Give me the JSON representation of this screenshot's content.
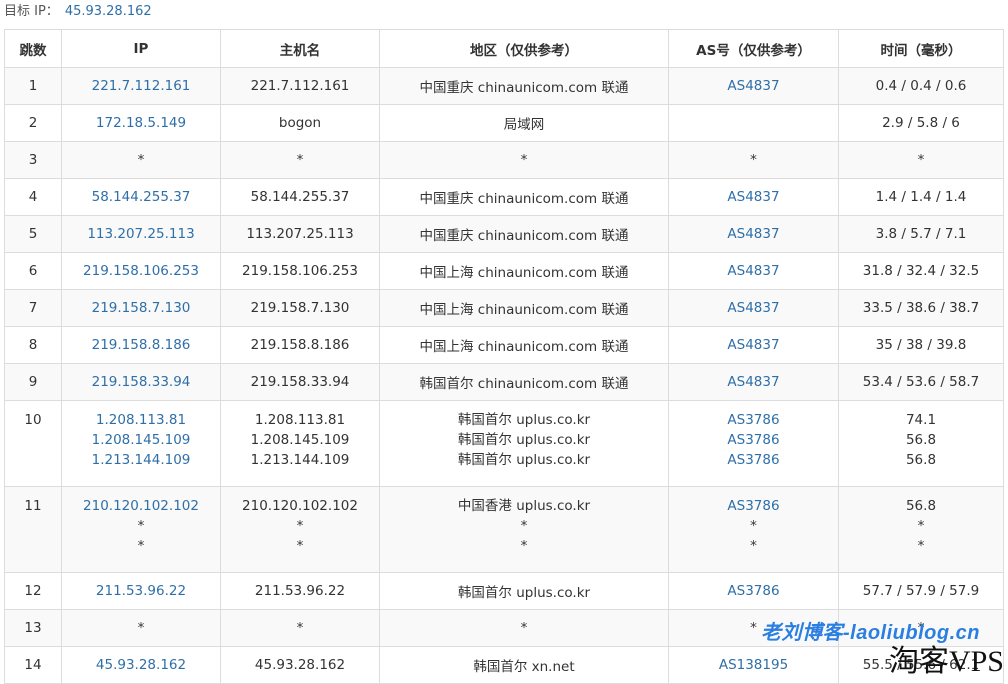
{
  "target": {
    "label": "目标 IP：",
    "ip": "45.93.28.162"
  },
  "headers": [
    "跳数",
    "IP",
    "主机名",
    "地区（仅供参考）",
    "AS号（仅供参考）",
    "时间（毫秒）"
  ],
  "rows": [
    {
      "hop": "1",
      "ips": [
        "221.7.112.161"
      ],
      "hosts": [
        "221.7.112.161"
      ],
      "regions": [
        "中国重庆 chinaunicom.com 联通"
      ],
      "as": [
        "AS4837"
      ],
      "times": [
        "0.4 / 0.4 / 0.6"
      ]
    },
    {
      "hop": "2",
      "ips": [
        "172.18.5.149"
      ],
      "hosts": [
        "bogon"
      ],
      "regions": [
        "局域网"
      ],
      "as": [
        ""
      ],
      "times": [
        "2.9 / 5.8 / 6"
      ]
    },
    {
      "hop": "3",
      "ips": [
        "*"
      ],
      "hosts": [
        "*"
      ],
      "regions": [
        "*"
      ],
      "as": [
        "*"
      ],
      "times": [
        "*"
      ]
    },
    {
      "hop": "4",
      "ips": [
        "58.144.255.37"
      ],
      "hosts": [
        "58.144.255.37"
      ],
      "regions": [
        "中国重庆 chinaunicom.com 联通"
      ],
      "as": [
        "AS4837"
      ],
      "times": [
        "1.4 / 1.4 / 1.4"
      ]
    },
    {
      "hop": "5",
      "ips": [
        "113.207.25.113"
      ],
      "hosts": [
        "113.207.25.113"
      ],
      "regions": [
        "中国重庆 chinaunicom.com 联通"
      ],
      "as": [
        "AS4837"
      ],
      "times": [
        "3.8 / 5.7 / 7.1"
      ]
    },
    {
      "hop": "6",
      "ips": [
        "219.158.106.253"
      ],
      "hosts": [
        "219.158.106.253"
      ],
      "regions": [
        "中国上海 chinaunicom.com 联通"
      ],
      "as": [
        "AS4837"
      ],
      "times": [
        "31.8 / 32.4 / 32.5"
      ]
    },
    {
      "hop": "7",
      "ips": [
        "219.158.7.130"
      ],
      "hosts": [
        "219.158.7.130"
      ],
      "regions": [
        "中国上海 chinaunicom.com 联通"
      ],
      "as": [
        "AS4837"
      ],
      "times": [
        "33.5 / 38.6 / 38.7"
      ]
    },
    {
      "hop": "8",
      "ips": [
        "219.158.8.186"
      ],
      "hosts": [
        "219.158.8.186"
      ],
      "regions": [
        "中国上海 chinaunicom.com 联通"
      ],
      "as": [
        "AS4837"
      ],
      "times": [
        "35 / 38 / 39.8"
      ]
    },
    {
      "hop": "9",
      "ips": [
        "219.158.33.94"
      ],
      "hosts": [
        "219.158.33.94"
      ],
      "regions": [
        "韩国首尔 chinaunicom.com 联通"
      ],
      "as": [
        "AS4837"
      ],
      "times": [
        "53.4 / 53.6 / 58.7"
      ]
    },
    {
      "hop": "10",
      "ips": [
        "1.208.113.81",
        "1.208.145.109",
        "1.213.144.109"
      ],
      "hosts": [
        "1.208.113.81",
        "1.208.145.109",
        "1.213.144.109"
      ],
      "regions": [
        "韩国首尔 uplus.co.kr",
        "韩国首尔 uplus.co.kr",
        "韩国首尔 uplus.co.kr"
      ],
      "as": [
        "AS3786",
        "AS3786",
        "AS3786"
      ],
      "times": [
        "74.1",
        "56.8",
        "56.8"
      ]
    },
    {
      "hop": "11",
      "ips": [
        "210.120.102.102",
        "*",
        "*"
      ],
      "hosts": [
        "210.120.102.102",
        "*",
        "*"
      ],
      "regions": [
        "中国香港 uplus.co.kr",
        "*",
        "*"
      ],
      "as": [
        "AS3786",
        "*",
        "*"
      ],
      "times": [
        "56.8",
        "*",
        "*"
      ]
    },
    {
      "hop": "12",
      "ips": [
        "211.53.96.22"
      ],
      "hosts": [
        "211.53.96.22"
      ],
      "regions": [
        "韩国首尔 uplus.co.kr"
      ],
      "as": [
        "AS3786"
      ],
      "times": [
        "57.7 / 57.9 / 57.9"
      ]
    },
    {
      "hop": "13",
      "ips": [
        "*"
      ],
      "hosts": [
        "*"
      ],
      "regions": [
        "*"
      ],
      "as": [
        "*"
      ],
      "times": [
        "*"
      ]
    },
    {
      "hop": "14",
      "ips": [
        "45.93.28.162"
      ],
      "hosts": [
        "45.93.28.162"
      ],
      "regions": [
        "韩国首尔 xn.net"
      ],
      "as": [
        "AS138195"
      ],
      "times": [
        "55.5 / 55.6 / 62.1"
      ]
    }
  ],
  "watermark": {
    "text": "老刘博客-laoliublog.cn",
    "text2": "淘客VPS"
  },
  "colors": {
    "link": "#2f6fa8",
    "border": "#dcdcdc",
    "stripe": "#f9f9f9",
    "watermark": "#2a7fe0"
  }
}
